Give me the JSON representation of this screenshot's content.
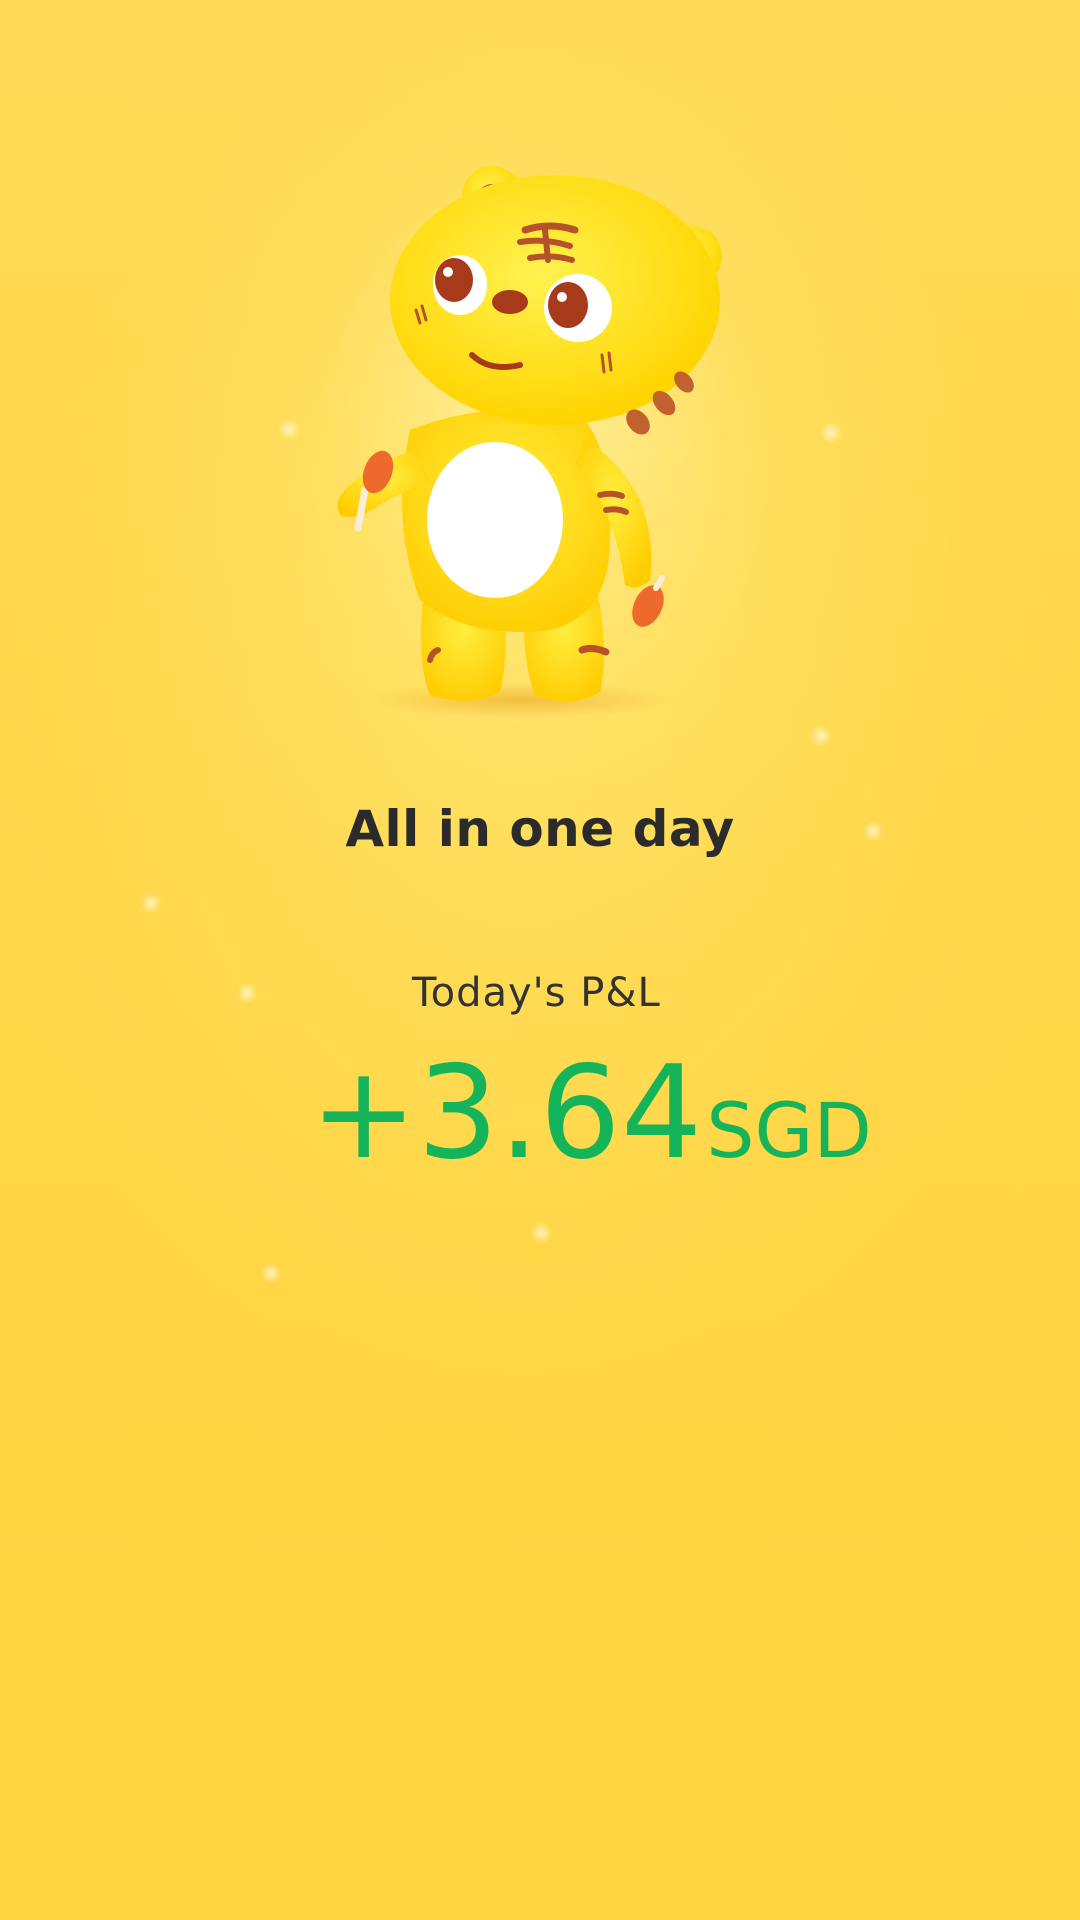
{
  "colors": {
    "background": "#FFD648",
    "headline": "#2B2B2B",
    "label": "#333333",
    "profit": "#15B45A",
    "mascot_body": "#FFE000",
    "mascot_belly": "#FFFFFF",
    "mascot_stripes": "#B5522A"
  },
  "mascot": {
    "icon": "tiger-mascot-illustration"
  },
  "headline": "All in one day",
  "pnl": {
    "label": "Today's P&L",
    "value": "+3.64",
    "currency": "SGD"
  }
}
